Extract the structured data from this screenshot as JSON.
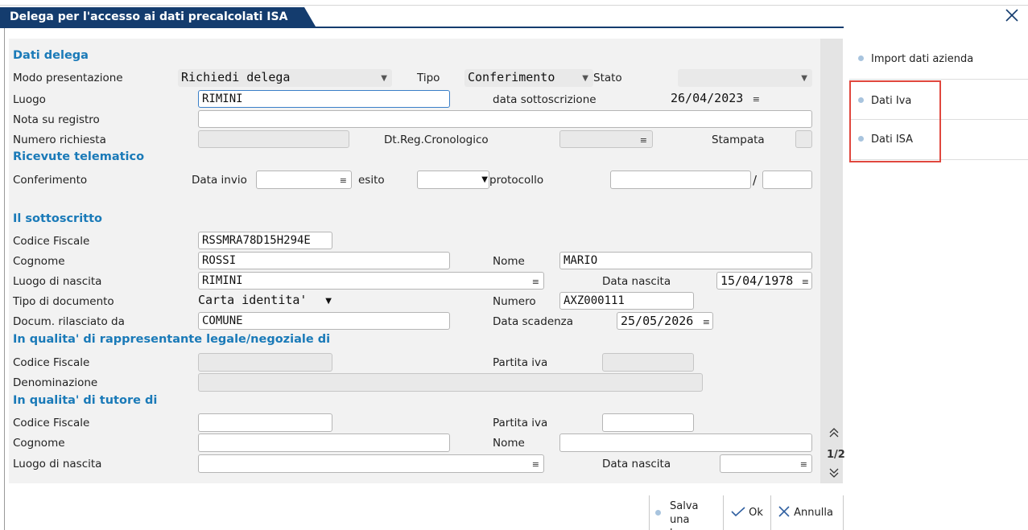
{
  "window": {
    "title": "Delega per l'accesso ai dati precalcolati ISA"
  },
  "sections": {
    "dati_delega": "Dati delega",
    "ricevute": "Ricevute telematico",
    "sottoscritto": "Il sottoscritto",
    "rappresentante": "In qualita' di rappresentante legale/negoziale di",
    "tutore": "In qualita' di tutore di"
  },
  "dati_delega": {
    "modo_label": "Modo presentazione",
    "modo_value": "Richiedi delega",
    "tipo_label": "Tipo",
    "tipo_value": "Conferimento",
    "stato_label": "Stato",
    "stato_value": "",
    "luogo_label": "Luogo",
    "luogo_value": "RIMINI",
    "data_sott_label": "data sottoscrizione",
    "data_sott_value": "26/04/2023",
    "nota_label": "Nota su registro",
    "nota_value": "",
    "num_rich_label": "Numero richiesta",
    "num_rich_value": "",
    "dt_reg_label": "Dt.Reg.Cronologico",
    "dt_reg_value": "",
    "stampata_label": "Stampata"
  },
  "ricevute": {
    "conferimento_label": "Conferimento",
    "data_invio_label": "Data invio",
    "data_invio_value": "",
    "esito_label": "esito",
    "esito_value": "",
    "protocollo_label": "protocollo",
    "protocollo_value": "",
    "protocollo_sep": "/",
    "protocollo_value2": ""
  },
  "sottoscritto": {
    "cf_label": "Codice Fiscale",
    "cf_value": "RSSMRA78D15H294E",
    "cognome_label": "Cognome",
    "cognome_value": "ROSSI",
    "nome_label": "Nome",
    "nome_value": "MARIO",
    "luogo_nascita_label": "Luogo di nascita",
    "luogo_nascita_value": "RIMINI",
    "data_nascita_label": "Data nascita",
    "data_nascita_value": "15/04/1978",
    "tipo_doc_label": "Tipo di documento",
    "tipo_doc_value": "Carta identita'",
    "numero_label": "Numero",
    "numero_value": "AXZ000111",
    "rilasciato_label": "Docum. rilasciato da",
    "rilasciato_value": "COMUNE",
    "scadenza_label": "Data scadenza",
    "scadenza_value": "25/05/2026"
  },
  "rappresentante": {
    "cf_label": "Codice Fiscale",
    "piva_label": "Partita iva",
    "denominazione_label": "Denominazione"
  },
  "tutore": {
    "cf_label": "Codice Fiscale",
    "piva_label": "Partita iva",
    "cognome_label": "Cognome",
    "nome_label": "Nome",
    "luogo_nascita_label": "Luogo di nascita",
    "data_nascita_label": "Data nascita"
  },
  "pager": {
    "page": "1/2"
  },
  "sidebar": {
    "items": [
      {
        "label": "Import dati azienda"
      },
      {
        "label": "Dati Iva"
      },
      {
        "label": "Dati ISA"
      }
    ],
    "highlight_color": "#e0473e"
  },
  "footer": {
    "salva_label": "Salva una bozza",
    "ok_label": "Ok",
    "annulla_label": "Annulla"
  },
  "colors": {
    "title_bg": "#143c6e",
    "section_text": "#1a7ab8",
    "panel_bg": "#f2f2f2"
  }
}
